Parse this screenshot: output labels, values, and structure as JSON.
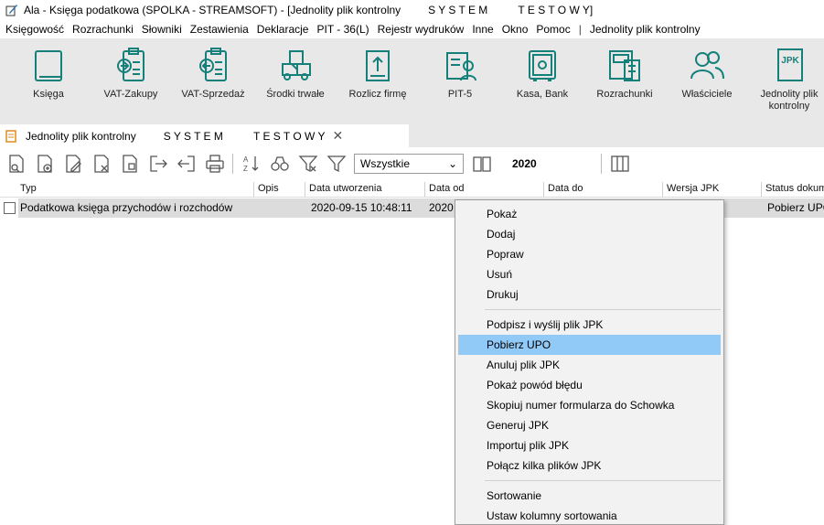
{
  "window": {
    "title": "Ala - Księga podatkowa (SPOLKA - STREAMSOFT) - [Jednolity plik kontrolny         S Y S T E M          T E S T O W Y]"
  },
  "menu": [
    {
      "label": "Księgowość"
    },
    {
      "label": "Rozrachunki"
    },
    {
      "label": "Słowniki"
    },
    {
      "label": "Zestawienia"
    },
    {
      "label": "Deklaracje"
    },
    {
      "label": "PIT - 36(L)"
    },
    {
      "label": "Rejestr wydruków"
    },
    {
      "label": "Inne"
    },
    {
      "label": "Okno"
    },
    {
      "label": "Pomoc"
    },
    {
      "label": "Jednolity plik kontrolny"
    }
  ],
  "menu_separator": "|",
  "ribbon": [
    {
      "label": "Księga",
      "icon": "book-icon"
    },
    {
      "label": "VAT-Zakupy",
      "icon": "clipboard-in-icon"
    },
    {
      "label": "VAT-Sprzedaż",
      "icon": "clipboard-out-icon"
    },
    {
      "label": "Środki trwałe",
      "icon": "truck-icon"
    },
    {
      "label": "Rozlicz firmę",
      "icon": "upload-document-icon"
    },
    {
      "label": "PIT-5",
      "icon": "person-document-icon"
    },
    {
      "label": "Kasa, Bank",
      "icon": "safe-icon"
    },
    {
      "label": "Rozrachunki",
      "icon": "cash-register-icon"
    },
    {
      "label": "Właściciele",
      "icon": "people-icon"
    },
    {
      "label": "Jednolity plik kontrolny",
      "icon": "jpk-icon",
      "badge": "JPK"
    }
  ],
  "tab": {
    "title": "Jednolity plik kontrolny         S Y S T E M          T E S T O W Y",
    "close": "✕"
  },
  "toolbar": {
    "filter_value": "Wszystkie",
    "year": "2020"
  },
  "grid": {
    "columns": [
      "Typ",
      "Opis",
      "Data utworzenia",
      "Data od",
      "Data do",
      "Wersja JPK",
      "Status dokumentu"
    ],
    "rows": [
      {
        "typ": "Podatkowa księga przychodów i rozchodów",
        "opis": "",
        "data_utworzenia": "2020-09-15 10:48:11",
        "data_od": "2020",
        "data_do": "",
        "wersja": "",
        "status": "Pobierz UPO"
      }
    ]
  },
  "context_menu": {
    "group1": [
      "Pokaż",
      "Dodaj",
      "Popraw",
      "Usuń",
      "Drukuj"
    ],
    "group2": [
      "Podpisz i wyślij plik JPK",
      "Pobierz UPO",
      "Anuluj plik JPK",
      "Pokaż powód błędu",
      "Skopiuj numer formularza do Schowka",
      "Generuj JPK",
      "Importuj plik JPK",
      "Połącz kilka plików JPK"
    ],
    "group3": [
      "Sortowanie",
      "Ustaw kolumny sortowania"
    ],
    "highlighted": "Pobierz UPO",
    "highlight_color": "#91c9f7"
  }
}
